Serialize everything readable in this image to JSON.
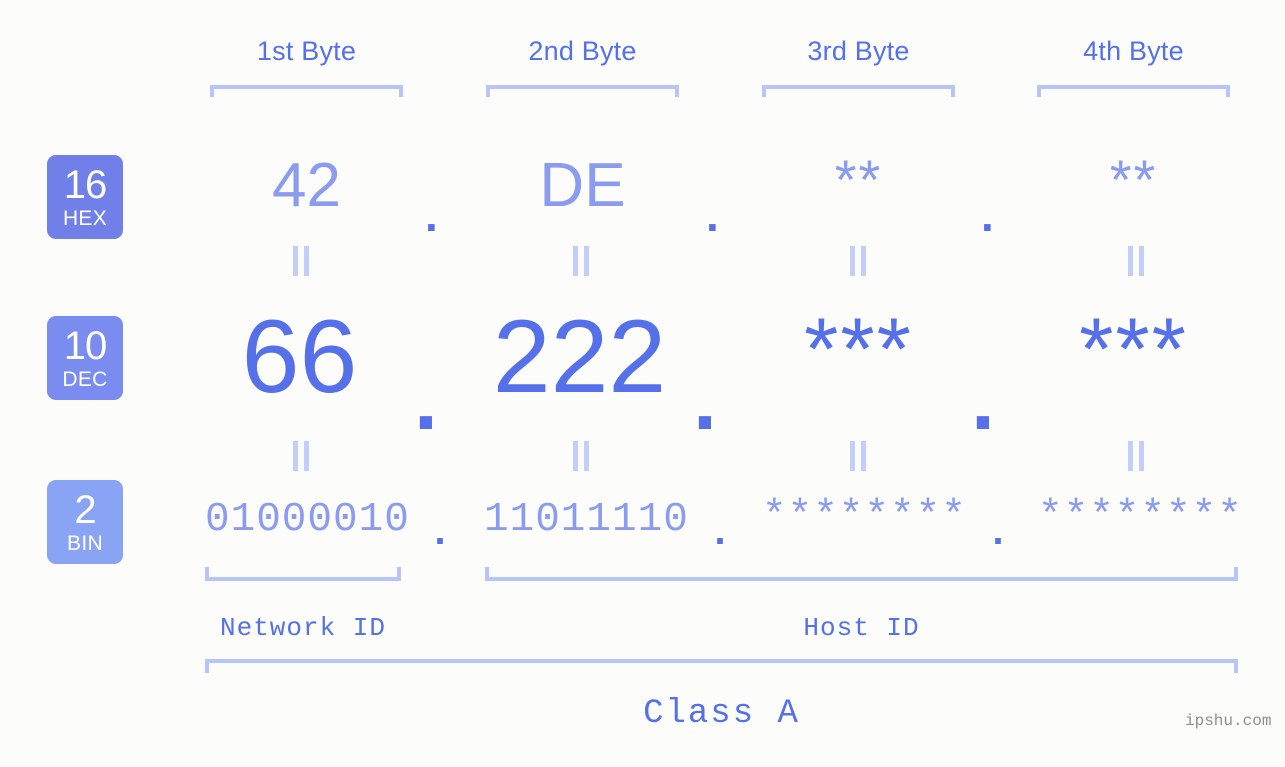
{
  "page": {
    "background_color": "#fcfdfa",
    "accent_color": "#5570e8",
    "muted_accent_color": "#8a9bf0",
    "bracket_color": "#b9c5f8",
    "watermark": "ipshu.com"
  },
  "byte_headers": [
    {
      "label": "1st Byte"
    },
    {
      "label": "2nd Byte"
    },
    {
      "label": "3rd Byte"
    },
    {
      "label": "4th Byte"
    }
  ],
  "rows": [
    {
      "id": "hex",
      "badge_number": "16",
      "badge_name": "HEX",
      "badge_color": "#7080e8",
      "values": [
        "42",
        "DE",
        "**",
        "**"
      ],
      "separator": "."
    },
    {
      "id": "dec",
      "badge_number": "10",
      "badge_name": "DEC",
      "badge_color": "#7b8cf0",
      "values": [
        "66",
        "222",
        "***",
        "***"
      ],
      "separator": "."
    },
    {
      "id": "bin",
      "badge_number": "2",
      "badge_name": "BIN",
      "badge_color": "#8aa4f5",
      "values": [
        "01000010",
        "11011110",
        "********",
        "********"
      ],
      "separator": "."
    }
  ],
  "equals_marks": {
    "glyph": "||",
    "count_per_gap": 4
  },
  "id_sections": [
    {
      "name": "network-id",
      "label": "Network ID"
    },
    {
      "name": "host-id",
      "label": "Host ID"
    }
  ],
  "class": {
    "label": "Class A"
  }
}
